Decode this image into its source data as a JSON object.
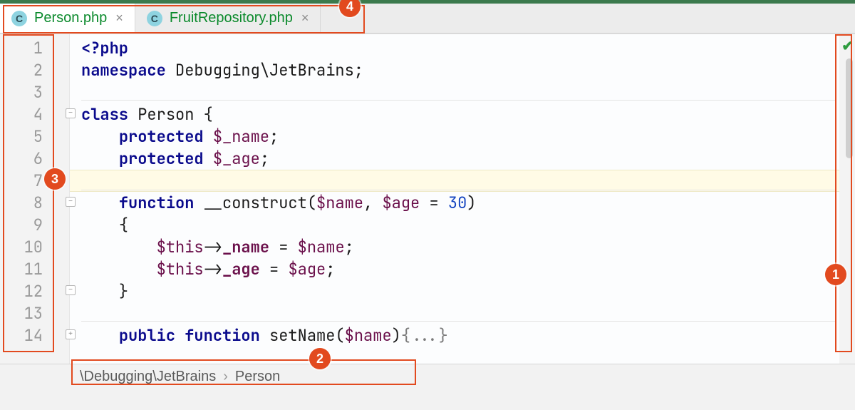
{
  "tabs": [
    {
      "icon": "C",
      "label": "Person.php",
      "active": true
    },
    {
      "icon": "C",
      "label": "FruitRepository.php",
      "active": false
    }
  ],
  "gutter": {
    "lines": [
      "1",
      "2",
      "3",
      "4",
      "5",
      "6",
      "7",
      "8",
      "9",
      "10",
      "11",
      "12",
      "13",
      "14"
    ]
  },
  "code": {
    "l1_open": "<?php",
    "l2_ns": "namespace",
    "l2_rest": " Debugging\\JetBrains;",
    "l4_class": "class",
    "l4_rest": " Person {",
    "l5_kw": "protected",
    "l5_var": " $_name",
    "l5_semi": ";",
    "l6_kw": "protected",
    "l6_var": " $_age",
    "l6_semi": ";",
    "l8_fn": "function",
    "l8_name": " __construct(",
    "l8_p1": "$name",
    "l8_c1": ", ",
    "l8_p2": "$age",
    "l8_eq": " = ",
    "l8_num": "30",
    "l8_close": ")",
    "l9_brace": "{",
    "l10_this": "$this",
    "l10_arrow": "->",
    "l10_field": "_name",
    "l10_eq": " = ",
    "l10_rhs": "$name",
    "l10_semi": ";",
    "l11_this": "$this",
    "l11_arrow": "->",
    "l11_field": "_age",
    "l11_eq": " = ",
    "l11_rhs": "$age",
    "l11_semi": ";",
    "l12_brace": "}",
    "l14_vis": "public",
    "l14_fn": " function",
    "l14_name": " setName(",
    "l14_p": "$name",
    "l14_close": ")",
    "l14_fold": "{...}"
  },
  "breadcrumb": {
    "part1": "\\Debugging\\JetBrains",
    "sep": "›",
    "part2": "Person"
  },
  "callouts": {
    "c1": "1",
    "c2": "2",
    "c3": "3",
    "c4": "4"
  },
  "analysis": {
    "status": "ok"
  }
}
